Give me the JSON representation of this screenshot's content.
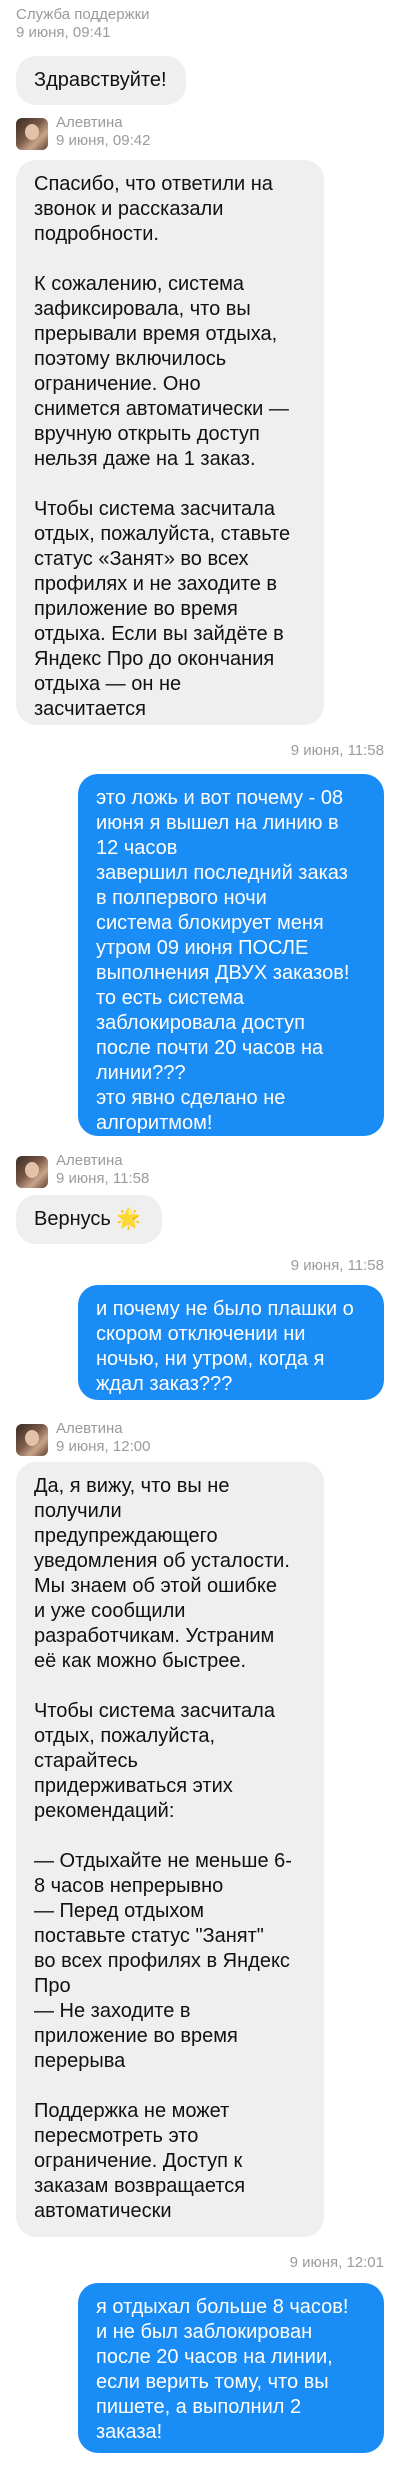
{
  "messages": [
    {
      "sender": "Служба поддержки",
      "time": "9 июня, 09:41",
      "text": "Здравствуйте!"
    },
    {
      "sender": "Алевтина",
      "time": "9 июня, 09:42",
      "text": "Спасибо, что ответили на\nзвонок и рассказали\nподробности.\n\nК сожалению, система\nзафиксировала, что вы\nпрерывали время отдыха,\nпоэтому включилось\nограничение. Оно\nснимется автоматически —\nвручную открыть доступ\nнельзя даже на 1 заказ.\n\nЧтобы система засчитала\nотдых, пожалуйста, ставьте\nстатус «Занят» во всех\nпрофилях и не заходите в\nприложение во время\nотдыха. Если вы зайдёте в\nЯндекс Про до окончания\nотдыха — он не\nзасчитается"
    },
    {
      "time": "9 июня, 11:58",
      "text": "это ложь и вот почему - 08\nиюня я вышел на линию в\n12 часов\nзавершил последний заказ\nв полпервого ночи\nсистема блокирует меня\nутром 09 июня ПОСЛЕ\nвыполнения ДВУХ заказов!\nто есть система\nзаблокировала доступ\nпосле почти 20 часов на\nлинии???\nэто явно сделано не\nалгоритмом!"
    },
    {
      "sender": "Алевтина",
      "time": "9 июня, 11:58",
      "text": "Вернусь 🌟"
    },
    {
      "time": "9 июня, 11:58",
      "text": "и почему не было плашки о\nскором отключении ни\nночью, ни утром, когда я\nждал заказ???"
    },
    {
      "sender": "Алевтина",
      "time": "9 июня, 12:00",
      "text": "Да, я вижу, что вы не\nполучили\nпредупреждающего\nуведомления об усталости.\nМы знаем об этой ошибке\nи уже сообщили\nразработчикам. Устраним\nеё как можно быстрее.\n\nЧтобы система засчитала\nотдых, пожалуйста,\nстарайтесь\nпридерживаться этих\nрекомендаций:\n\n— Отдыхайте не меньше 6-\n8 часов непрерывно\n— Перед отдыхом\nпоставьте статус \"Занят\"\nво всех профилях в Яндекс\nПро\n— Не заходите в\nприложение во время\nперерыва\n\nПоддержка не может\nпересмотреть это\nограничение. Доступ к\nзаказам возвращается\nавтоматически"
    },
    {
      "time": "9 июня, 12:01",
      "text": "я отдыхал больше 8 часов!\nи не был заблокирован\nпосле 20 часов на линии,\nесли верить тому, что вы\nпишете, а выполнил 2\nзаказа!"
    }
  ]
}
